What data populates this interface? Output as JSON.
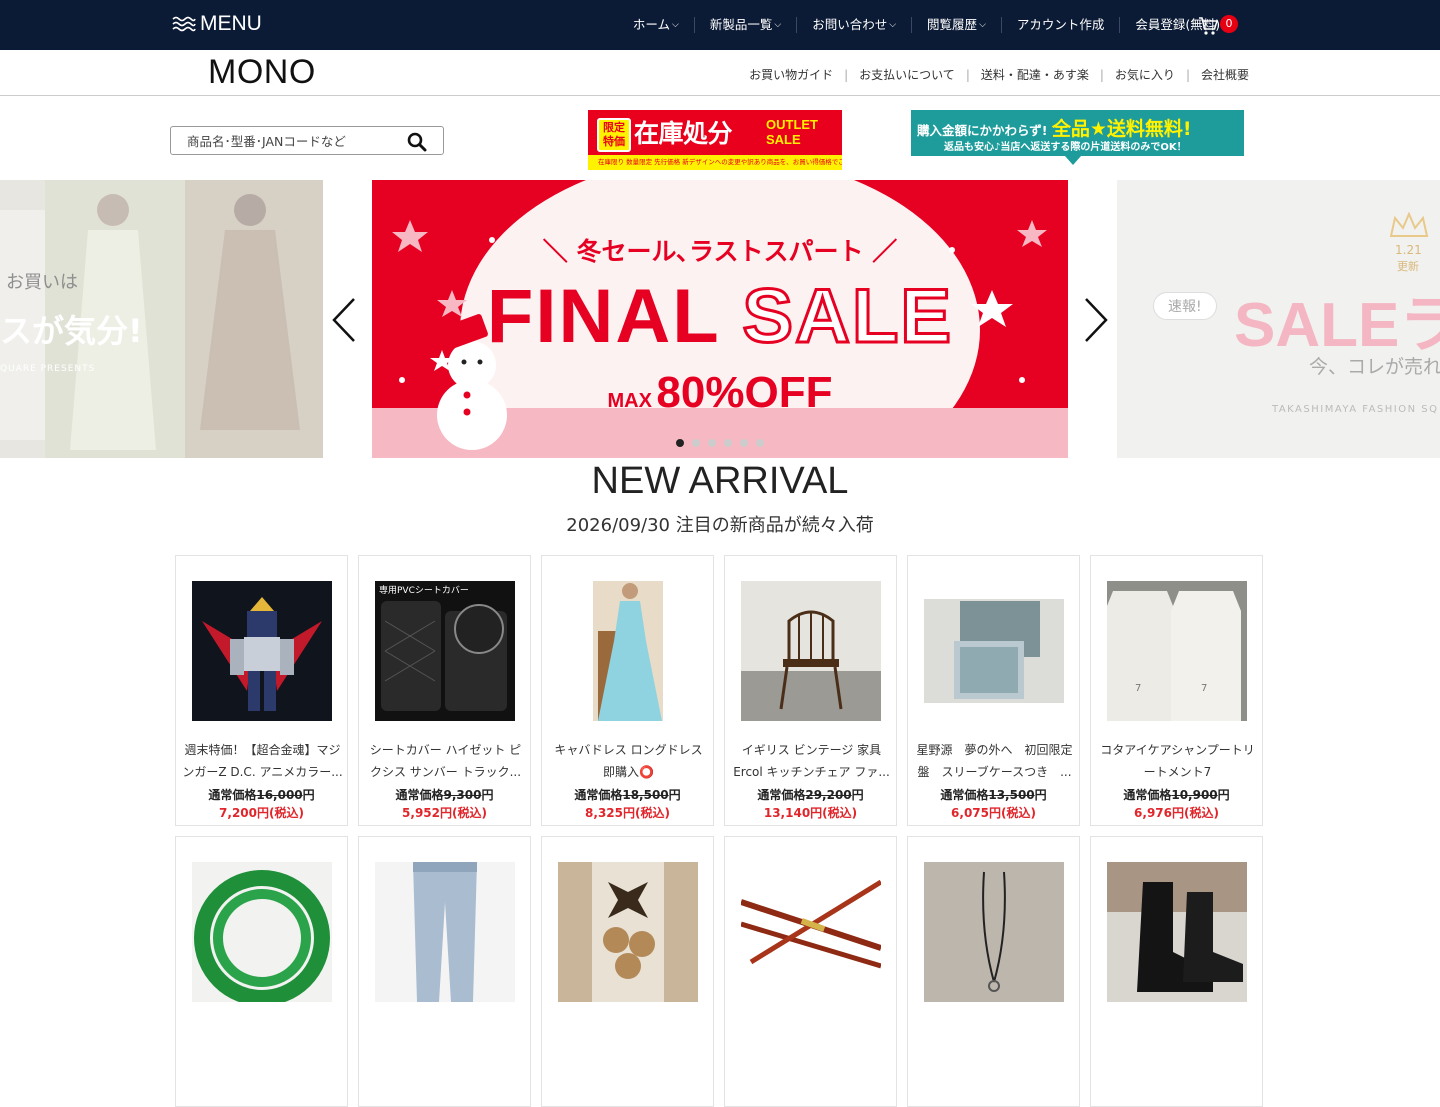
{
  "topbar": {
    "menu_label": "MENU",
    "nav": [
      {
        "label": "ホーム",
        "caret": true
      },
      {
        "label": "新製品一覧",
        "caret": true
      },
      {
        "label": "お問い合わせ",
        "caret": true
      },
      {
        "label": "閲覧履歴",
        "caret": true
      },
      {
        "label": "アカウント作成",
        "caret": false
      },
      {
        "label": "会員登録(無料)",
        "caret": true
      }
    ],
    "cart_count": "0"
  },
  "subheader": {
    "logo": "MONO",
    "links": [
      "お買い物ガイド",
      "お支払いについて",
      "送料・配達・あす楽",
      "お気に入り",
      "会社概要"
    ]
  },
  "search": {
    "placeholder": "商品名･型番･JANコードなど"
  },
  "promo_outlet": {
    "tag": "限定特価",
    "big": "在庫処分",
    "small_1": "OUTLET",
    "small_2": "SALE",
    "strip": "在庫限り 数量限定 先行価格 新デザインへの変更や訳あり商品を、お買い得価格でご提供"
  },
  "promo_freeship": {
    "line1_a": "購入金額にかかわらず! ",
    "line1_b": "全品★送料無料!",
    "line2": "返品も安心♪当店へ返送する際の片道送料のみでOK！"
  },
  "carousel": {
    "left": {
      "line1": "お買いは",
      "line2": "スが気分!",
      "line3": "QUARE PRESENTS"
    },
    "main": {
      "top": "＼ 冬セール､ラストスパート ／",
      "final": "FINAL",
      "sale": "SALE",
      "max": "MAX",
      "off": "80%OFF"
    },
    "right": {
      "date": "1.21",
      "upd": "更新",
      "badge": "速報!",
      "sale": "SALEラ",
      "sub": "今、コレが売れて",
      "brand": "TAKASHIMAYA FASHION SQ"
    },
    "dots": 6,
    "active_dot": 0
  },
  "new_arrival": {
    "title": "NEW ARRIVAL",
    "subtitle": "2026/09/30  注目の新商品が続々入荷"
  },
  "products": [
    {
      "name": "週末特価！【超合金魂】マジンガーZ D.C. アニメカラー...",
      "reg_label": "通常価格",
      "reg_price": "16,000",
      "reg_unit": "円",
      "sale": "7,200円(税込)"
    },
    {
      "name": "シートカバー ハイゼット ピクシス サンバー トラック...",
      "reg_label": "通常価格",
      "reg_price": "9,300",
      "reg_unit": "円",
      "sale": "5,952円(税込)"
    },
    {
      "name": "キャバドレス ロングドレス 即購入⭕",
      "reg_label": "通常価格",
      "reg_price": "18,500",
      "reg_unit": "円",
      "sale": "8,325円(税込)"
    },
    {
      "name": "イギリス ビンテージ 家具 Ercol キッチンチェア ファ...",
      "reg_label": "通常価格",
      "reg_price": "29,200",
      "reg_unit": "円",
      "sale": "13,140円(税込)"
    },
    {
      "name": "星野源　夢の外へ　初回限定盤　スリーブケースつき　...",
      "reg_label": "通常価格",
      "reg_price": "13,500",
      "reg_unit": "円",
      "sale": "6,075円(税込)"
    },
    {
      "name": "コタアイケアシャンプートリートメント7",
      "reg_label": "通常価格",
      "reg_price": "10,900",
      "reg_unit": "円",
      "sale": "6,976円(税込)"
    }
  ],
  "product_images_row1": [
    "robot",
    "seatcover",
    "dress",
    "chair",
    "cd",
    "shampoo"
  ],
  "product_images_row2": [
    "green-wire",
    "jeans",
    "cookies",
    "fishing-rod",
    "necklace",
    "boots"
  ],
  "colors": {
    "topbar": "#0c1b35",
    "accent_red": "#e0262b",
    "badge": "#e60012"
  }
}
